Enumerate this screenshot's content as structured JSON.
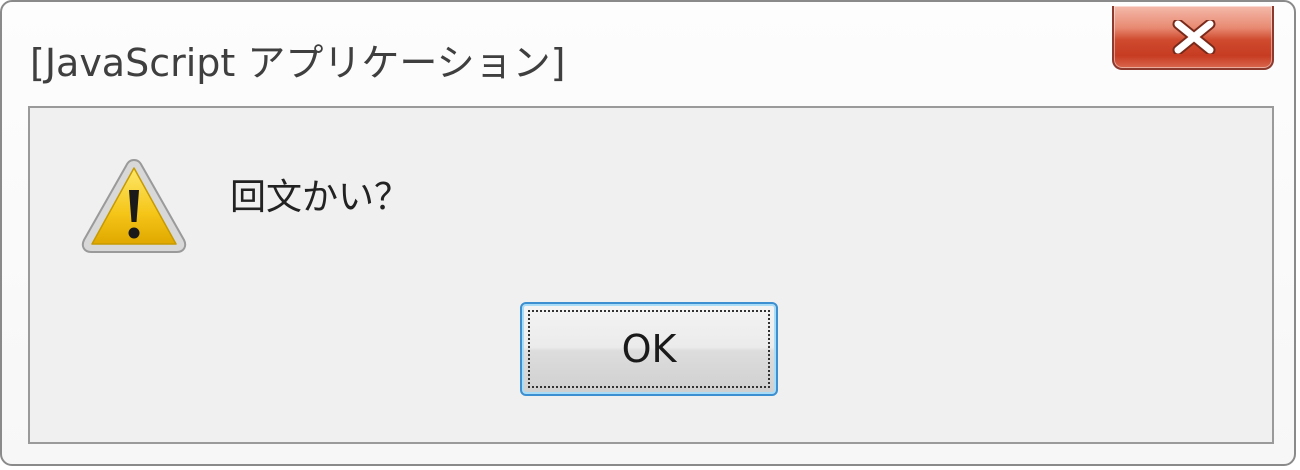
{
  "window": {
    "title": "[JavaScript アプリケーション]",
    "close_icon": "close-x-icon"
  },
  "dialog": {
    "icon": "warning-icon",
    "message": "回文かい？",
    "ok_label": "OK"
  },
  "colors": {
    "close_button": "#c63c22",
    "warning_yellow": "#f5c518",
    "focus_border": "#3c8fd0"
  }
}
